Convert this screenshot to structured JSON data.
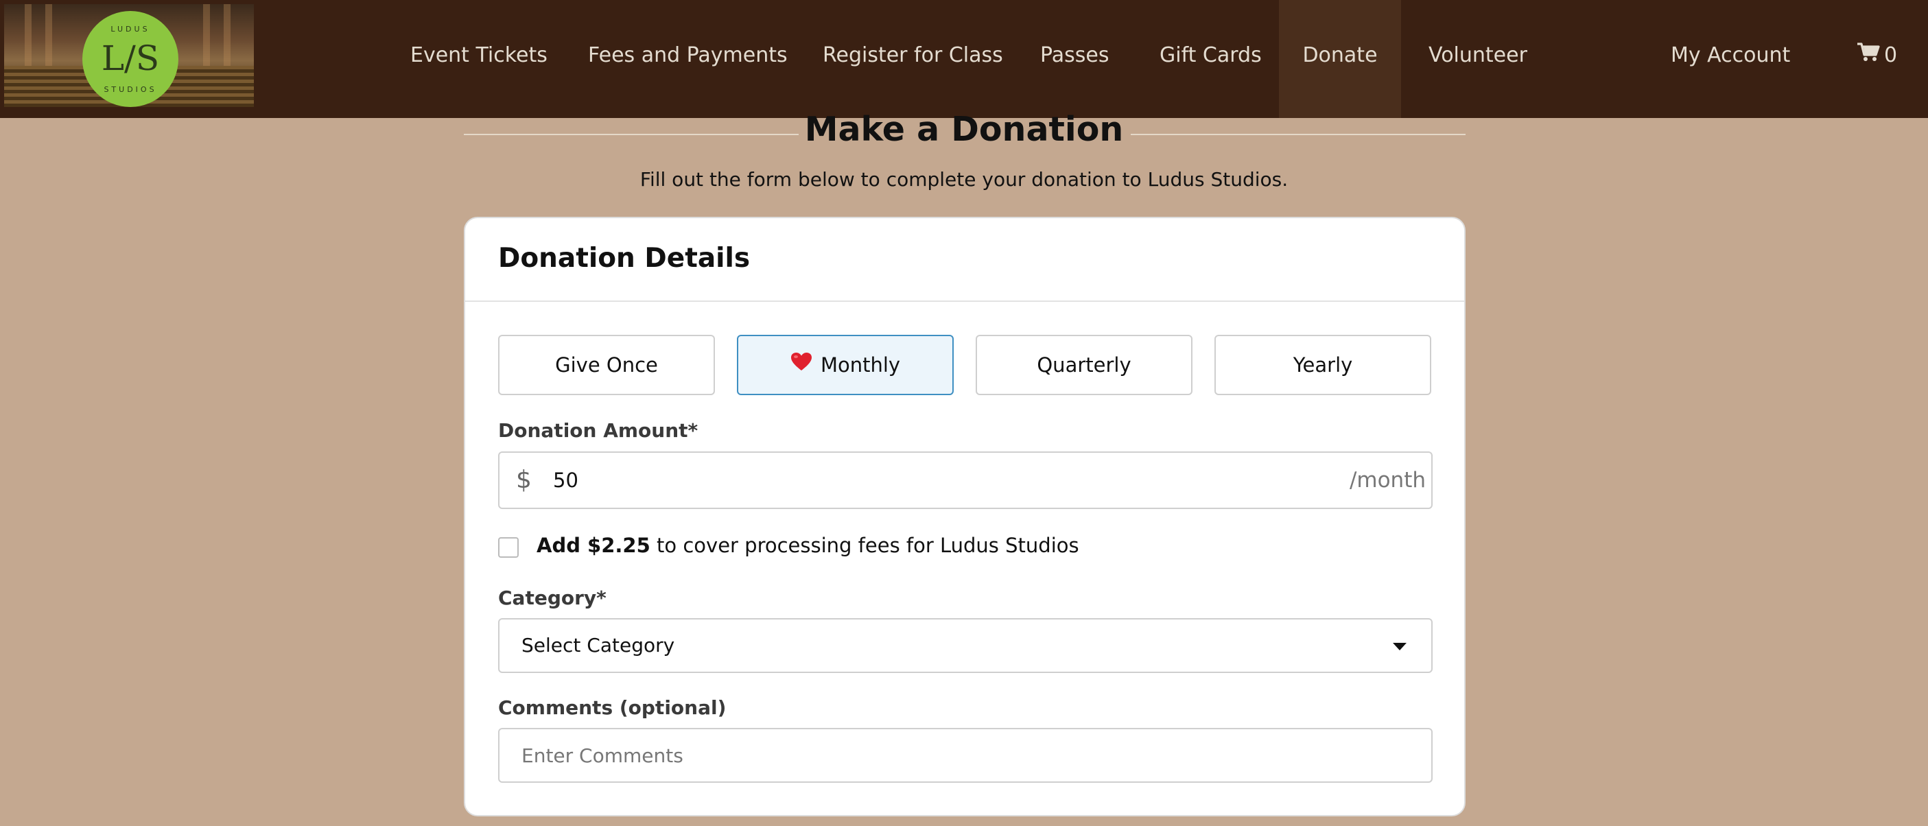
{
  "nav": {
    "logo": {
      "top_text": "LUDUS",
      "mark": "L/S",
      "bottom_text": "STUDIOS"
    },
    "items": [
      {
        "label": "Event Tickets"
      },
      {
        "label": "Fees and Payments"
      },
      {
        "label": "Register for Class"
      },
      {
        "label": "Passes"
      },
      {
        "label": "Gift Cards"
      },
      {
        "label": "Donate",
        "active": true
      },
      {
        "label": "Volunteer"
      }
    ],
    "account_label": "My Account",
    "cart_icon": "shopping-cart-icon",
    "cart_count": "0"
  },
  "page": {
    "title": "Make a Donation",
    "subtitle": "Fill out the form below to complete your donation to Ludus Studios."
  },
  "card": {
    "title": "Donation Details",
    "frequency_options": [
      {
        "label": "Give Once"
      },
      {
        "label": "Monthly",
        "selected": true,
        "icon": "heart-icon"
      },
      {
        "label": "Quarterly"
      },
      {
        "label": "Yearly"
      }
    ],
    "amount": {
      "label": "Donation Amount*",
      "currency_symbol": "$",
      "value": "50",
      "suffix": "/month"
    },
    "processing_fee": {
      "checked": false,
      "amount_text": "Add $2.25",
      "rest_text": "to cover processing fees for Ludus Studios"
    },
    "category": {
      "label": "Category*",
      "selected": "Select Category"
    },
    "comments": {
      "label": "Comments (optional)",
      "placeholder": "Enter Comments"
    }
  },
  "colors": {
    "nav_bg": "#3a2012",
    "page_bg": "#c4a890",
    "selected_border": "#3f8fc2",
    "selected_bg": "#ecf5fb",
    "logo_green": "#8cc63f"
  }
}
